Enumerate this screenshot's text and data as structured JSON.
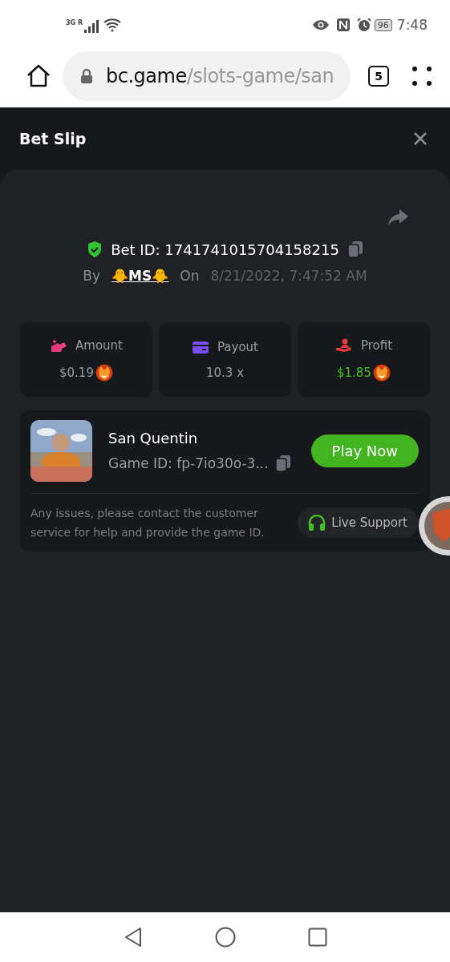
{
  "status_bar": {
    "network": "3G R",
    "battery": "96",
    "time": "7:48"
  },
  "browser": {
    "url_host": "bc.game",
    "url_path": "/slots-game/san",
    "tab_count": "5"
  },
  "bet_slip": {
    "title": "Bet Slip",
    "bet_id": "Bet ID: 1741741015704158215",
    "by_label": "By",
    "user": "🐥MS🐥",
    "on_label": "On",
    "date": "8/21/2022, 7:47:52 AM",
    "stats": [
      {
        "kind": "amount",
        "label": "Amount",
        "value": "$0.19",
        "coin": true
      },
      {
        "kind": "payout",
        "label": "Payout",
        "value": "10.3 x",
        "coin": false
      },
      {
        "kind": "profit",
        "label": "Profit",
        "value": "$1.85",
        "coin": true
      }
    ],
    "game": {
      "name": "San Quentin",
      "game_id": "Game ID: fp-7io30o-3...",
      "play_button": "Play Now",
      "note": "Any issues, please contact the customer service for help and provide the game ID.",
      "support_button": "Live Support"
    }
  }
}
